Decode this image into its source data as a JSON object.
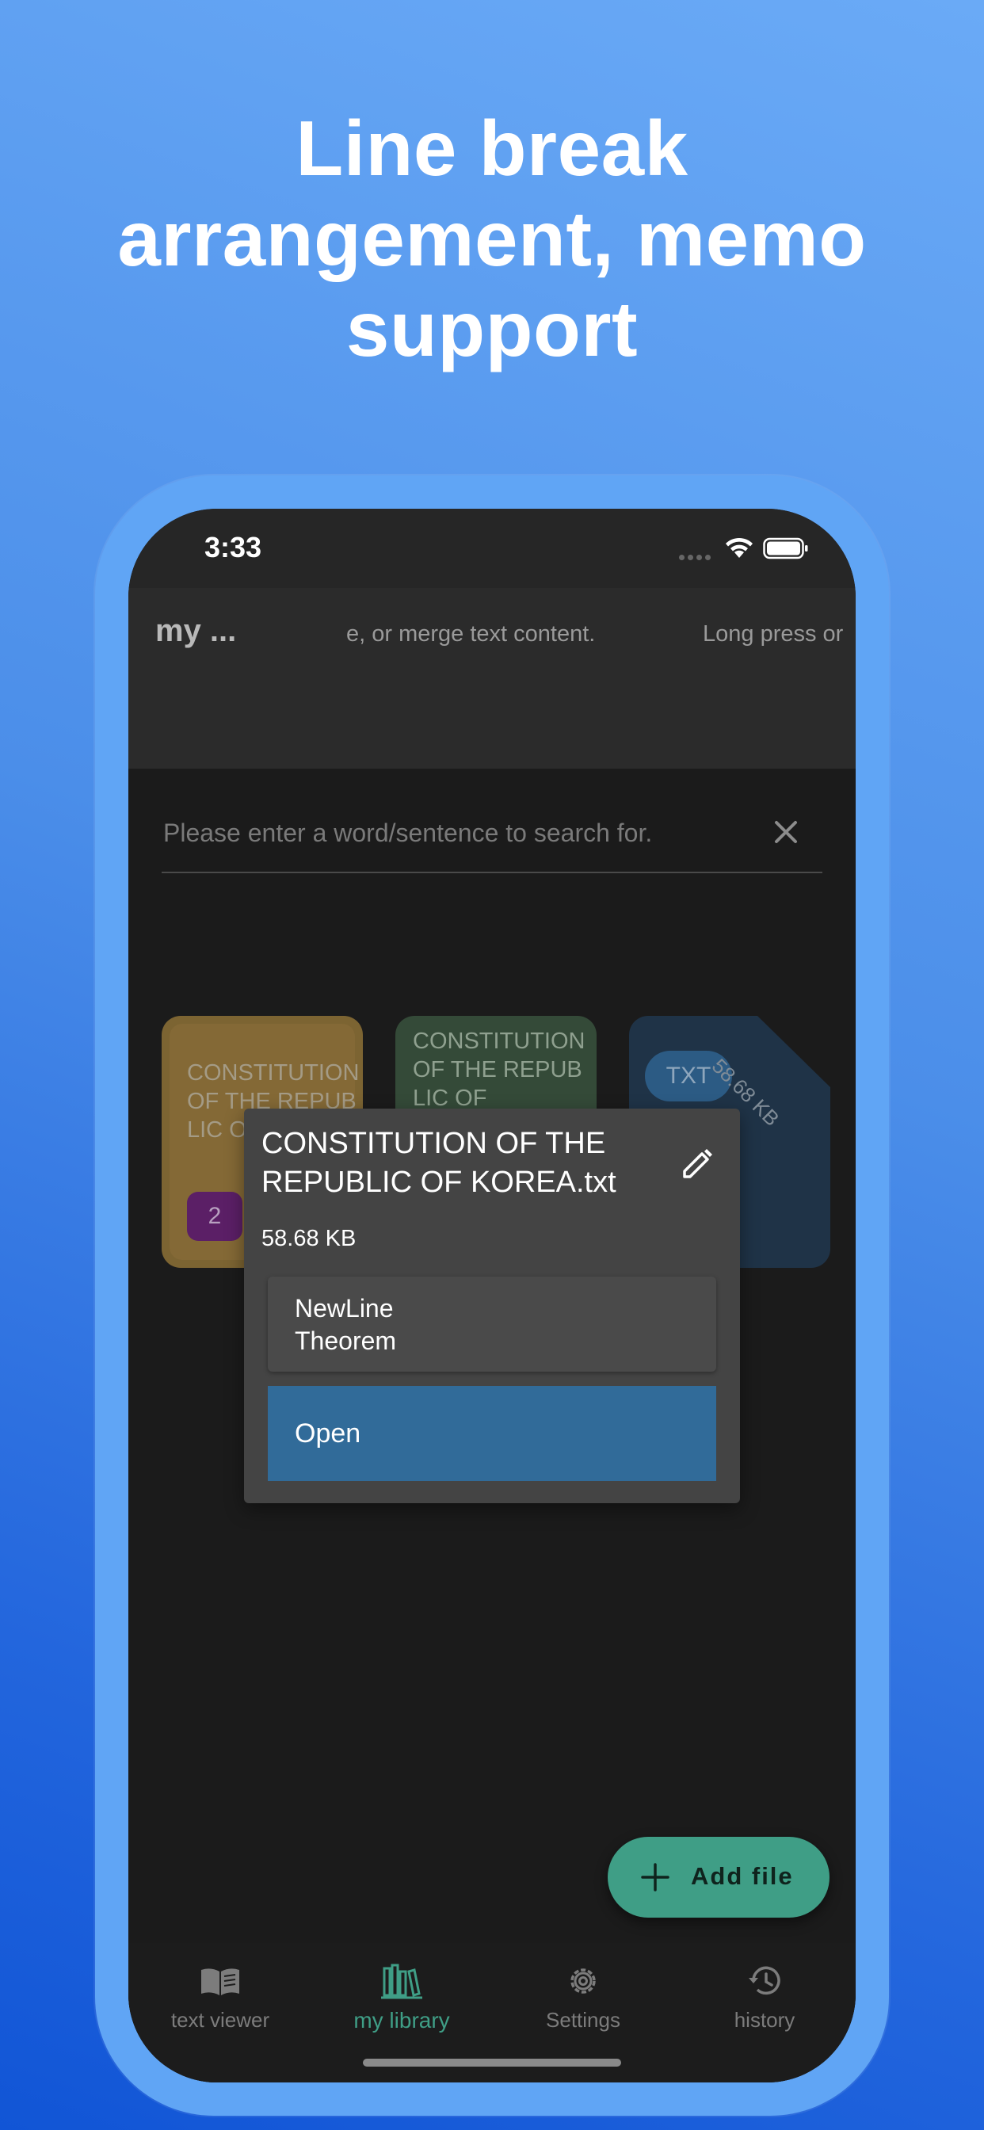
{
  "headline": {
    "line1": "Line break",
    "line2": "arrangement, memo",
    "line3": "support"
  },
  "statusbar": {
    "time": "3:33"
  },
  "appbar": {
    "title": "my ...",
    "marquee_1": "e, or merge text content.",
    "marquee_2": "Long press or"
  },
  "search": {
    "placeholder": "Please enter a word/sentence to search for.",
    "clear_icon": "close-icon"
  },
  "cards": [
    {
      "title": "CONSTITUTION OF THE REPUBLIC OF KOREA",
      "badge": "2",
      "color": "#7c6432"
    },
    {
      "title": "CONSTITUTION OF THE REPUBLIC OF",
      "color": "#344a38"
    },
    {
      "type_badge": "TXT",
      "size": "58.68 KB",
      "color": "#1f3347"
    }
  ],
  "popup": {
    "title": "CONSTITUTION OF THE REPUBLIC OF KOREA.txt",
    "size": "58.68 KB",
    "edit_icon": "pencil-icon",
    "newline_btn": {
      "line1": "NewLine",
      "line2": "Theorem"
    },
    "open_btn": "Open",
    "open_color": "#316b99"
  },
  "fab": {
    "label": "Add file",
    "icon": "plus-icon",
    "color": "#3f9e86"
  },
  "bottomnav": {
    "items": [
      {
        "label": "text viewer",
        "icon": "book-icon"
      },
      {
        "label": "my library",
        "icon": "library-icon",
        "active": true
      },
      {
        "label": "Settings",
        "icon": "gear-icon"
      },
      {
        "label": "history",
        "icon": "history-icon"
      }
    ],
    "active_color": "#3f9e86"
  }
}
